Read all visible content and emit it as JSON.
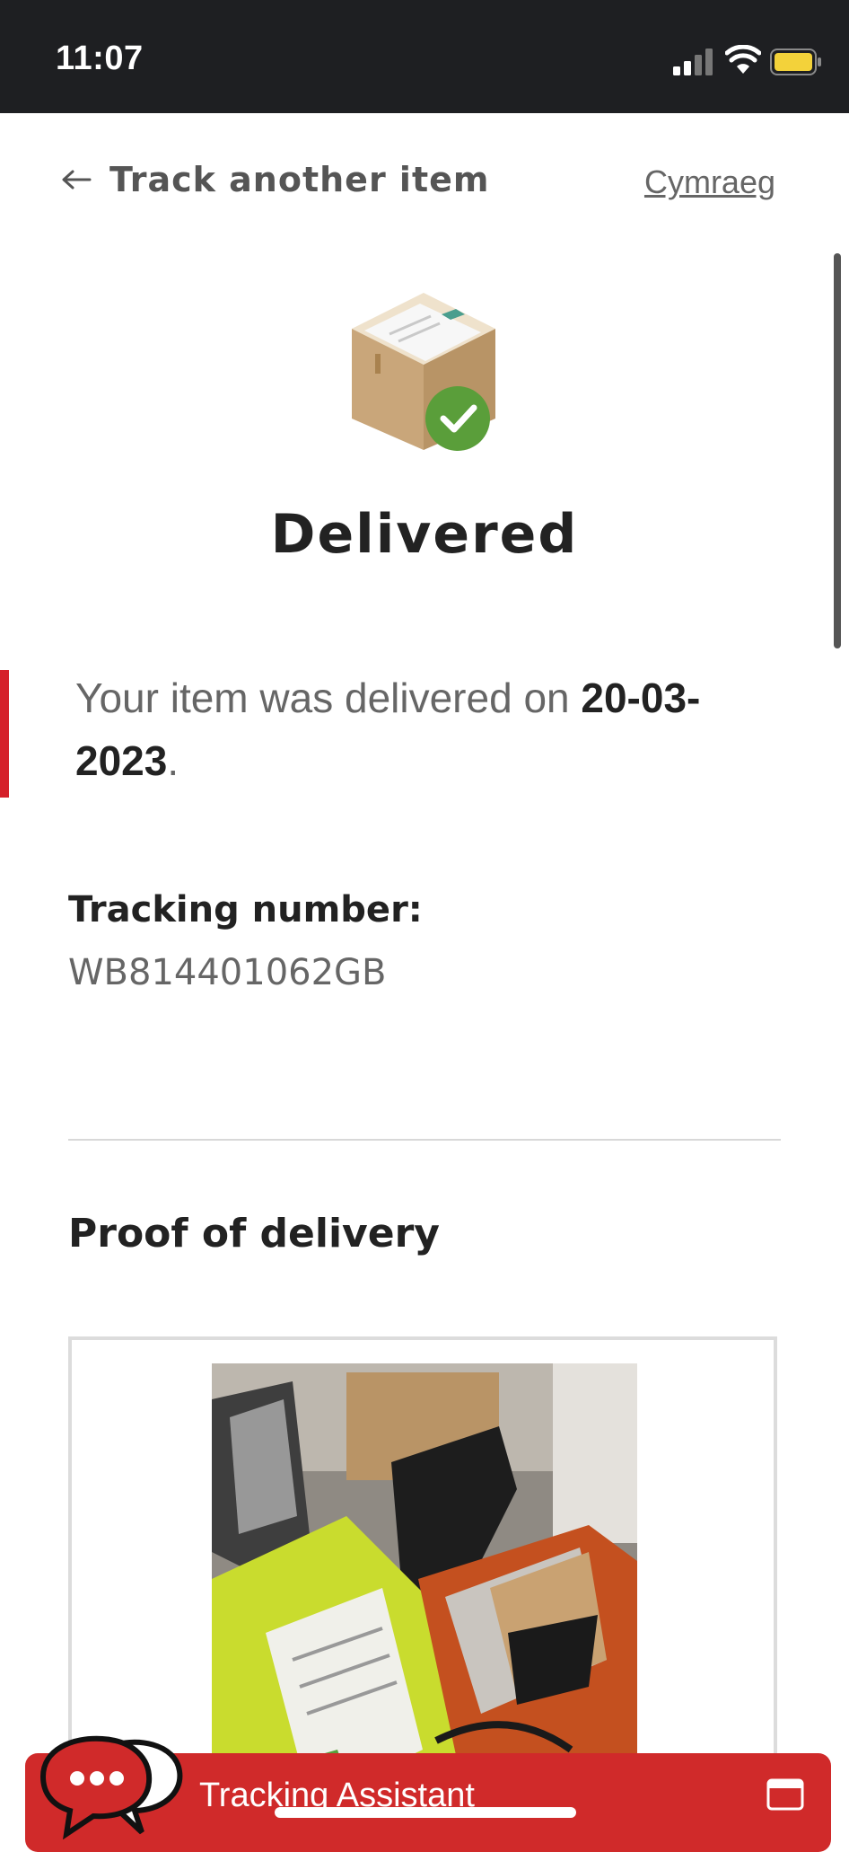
{
  "status_bar": {
    "time": "11:07"
  },
  "nav": {
    "back_label": "Track another item",
    "language_link": "Cymraeg"
  },
  "status": {
    "heading": "Delivered",
    "message_prefix": "Your item was delivered on ",
    "delivery_date": "20-03-2023",
    "message_suffix": "."
  },
  "tracking": {
    "label": "Tracking number:",
    "number": "WB814401062GB"
  },
  "proof": {
    "heading": "Proof of delivery"
  },
  "assistant": {
    "label": "Tracking Assistant"
  },
  "colors": {
    "accent": "#d5202a",
    "assistant_bg": "#d02a2a",
    "success": "#5a9e3a",
    "status_bar": "#1e1f22"
  },
  "icons": {
    "back": "arrow-left-icon",
    "package": "package-delivered-icon",
    "chat": "chat-bubbles-icon",
    "window": "window-icon"
  }
}
